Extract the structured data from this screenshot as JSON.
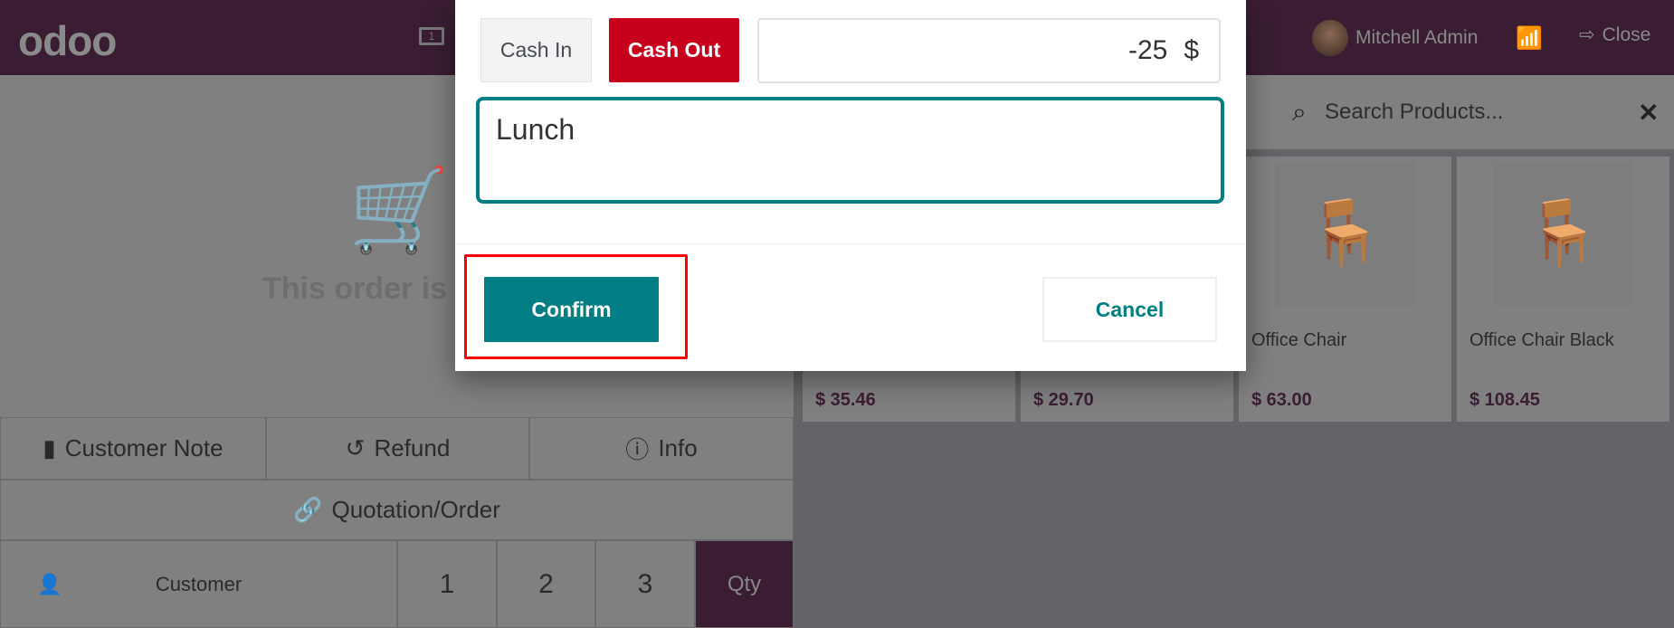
{
  "header": {
    "logo": "odoo",
    "cash_icon": "money-bill-icon",
    "cash_icon_text": "1",
    "user_name": "Mitchell Admin",
    "close_label": "Close"
  },
  "order": {
    "empty_text": "This order is e"
  },
  "actions": {
    "customer_note": "Customer Note",
    "refund": "Refund",
    "info": "Info",
    "quotation": "Quotation/Order"
  },
  "numpad": {
    "customer": "Customer",
    "k1": "1",
    "k2": "2",
    "k3": "3",
    "qty": "Qty"
  },
  "search": {
    "placeholder": "Search Products..."
  },
  "products": [
    {
      "name": "",
      "price": "$ 35.46"
    },
    {
      "name": "",
      "price": "$ 29.70"
    },
    {
      "name": "Office Chair",
      "price": "$ 63.00"
    },
    {
      "name": "Office Chair Black",
      "price": "$ 108.45"
    }
  ],
  "modal": {
    "cash_in": "Cash In",
    "cash_out": "Cash Out",
    "amount": "-25",
    "currency": "$",
    "reason": "Lunch",
    "confirm": "Confirm",
    "cancel": "Cancel"
  },
  "colors": {
    "accent": "#017e84",
    "cash_out": "#c7001c",
    "header": "#3a1d32",
    "highlight": "#ff0000"
  }
}
